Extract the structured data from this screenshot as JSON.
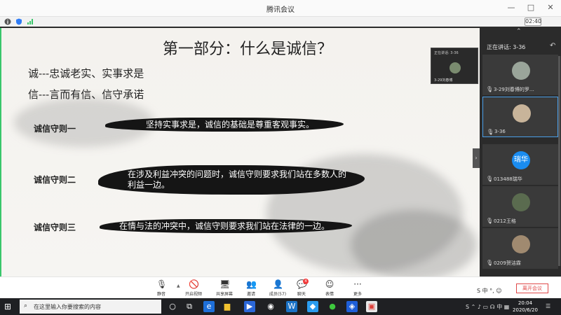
{
  "window": {
    "title": "腾讯会议",
    "minimize": "—",
    "maximize": "□",
    "close": "✕",
    "meeting_time": "02:40",
    "accent": "#39c66b"
  },
  "slide": {
    "title": "第一部分：什么是诚信？",
    "definitions": [
      "诚---忠诚老实、实事求是",
      "信---言而有信、信守承诺"
    ],
    "rules": [
      {
        "label": "诚信守则一",
        "text": "坚持实事求是，诚信的基础是尊重客观事实。"
      },
      {
        "label": "诚信守则二",
        "text": "在涉及利益冲突的问题时，诚信守则要求我们站在多数人的利益一边。"
      },
      {
        "label": "诚信守则三",
        "text": "在情与法的冲突中，诚信守则要求我们站在法律的一边。"
      }
    ]
  },
  "floating_preview": {
    "header": "正在讲话: 3-36",
    "name": "3-29刘春博"
  },
  "participants": {
    "speaking_label": "正在讲话: 3-36",
    "tiles": [
      {
        "name": "3-29刘春博的罗…",
        "avatar_text": ""
      },
      {
        "name": "3-36",
        "avatar_text": ""
      },
      {
        "name": "013488瑞华",
        "avatar_text": "瑞华"
      },
      {
        "name": "0212王格",
        "avatar_text": ""
      },
      {
        "name": "0209贺洁霖",
        "avatar_text": ""
      }
    ]
  },
  "toolbar": {
    "buttons": [
      {
        "label": "静音",
        "icon": "mic-icon"
      },
      {
        "label": "开启视频",
        "icon": "camera-off-icon"
      },
      {
        "label": "共享屏幕",
        "icon": "screen-share-icon"
      },
      {
        "label": "邀请",
        "icon": "invite-icon"
      },
      {
        "label": "成员(57)",
        "icon": "members-icon"
      },
      {
        "label": "聊天",
        "icon": "chat-icon"
      },
      {
        "label": "表情",
        "icon": "emoji-icon"
      },
      {
        "label": "更多",
        "icon": "more-icon"
      }
    ],
    "chat_badge": "4",
    "end_button": "离开会议",
    "end_color": "#e04848"
  },
  "taskbar": {
    "search_placeholder": "在这里输入你要搜索的内容",
    "time": "20:04",
    "date": "2020/6/20"
  }
}
